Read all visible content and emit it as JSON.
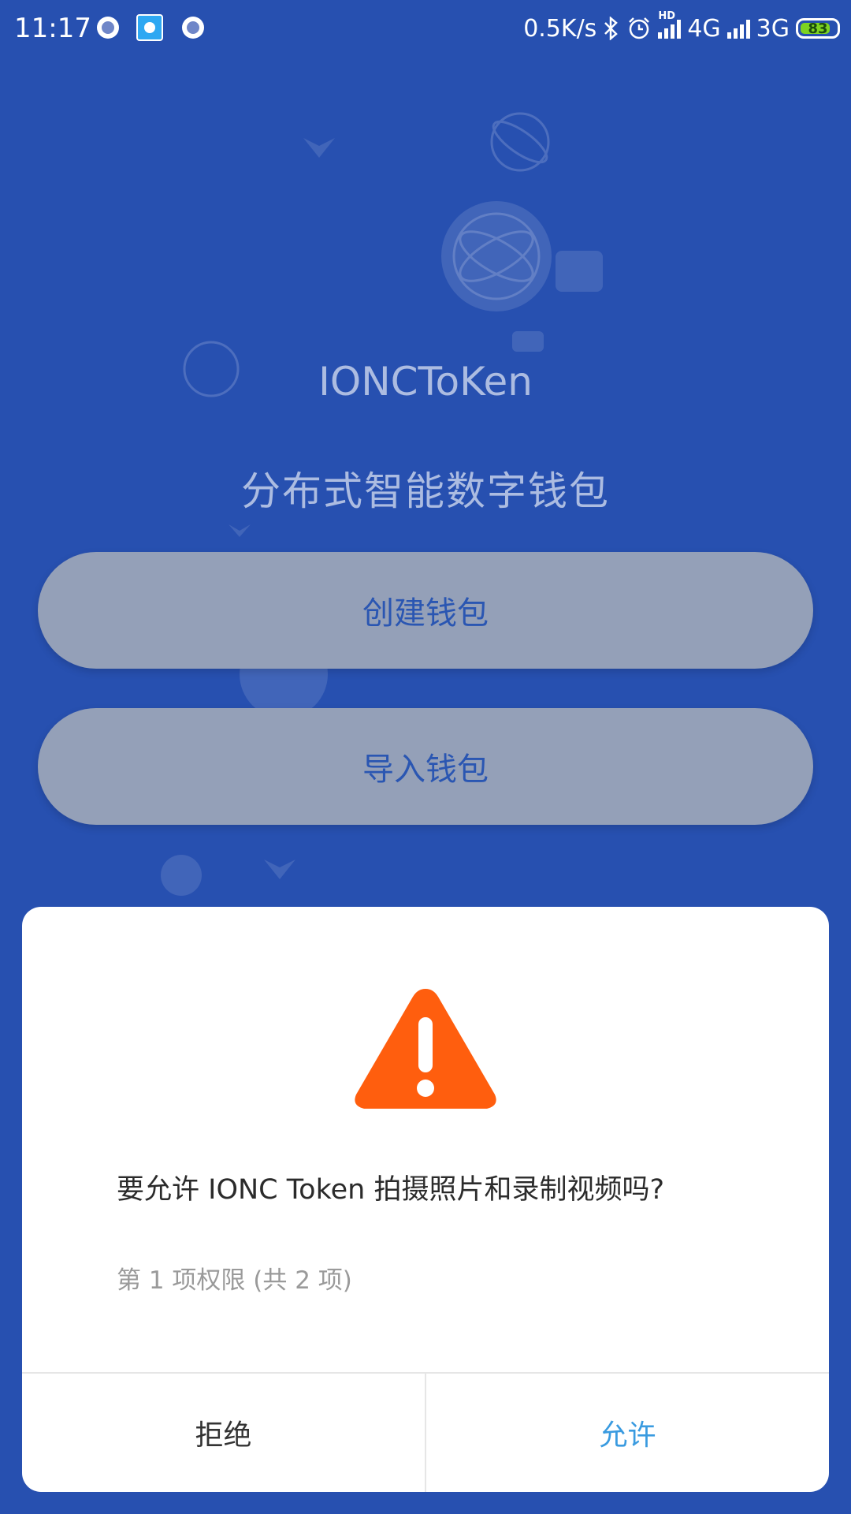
{
  "status_bar": {
    "time": "11:17",
    "speed": "0.5K/s",
    "network_primary": "4G",
    "network_hd": "HD",
    "network_secondary": "3G",
    "battery": "83",
    "icons": [
      "notification-ring-icon",
      "notification-app-icon",
      "notification-ring-icon",
      "bluetooth-icon",
      "alarm-icon",
      "signal-icon",
      "signal-icon",
      "battery-icon"
    ],
    "battery_level": 0.83
  },
  "app": {
    "title": "IONCToKen",
    "subtitle": "分布式智能数字钱包",
    "create_label": "创建钱包",
    "import_label": "导入钱包"
  },
  "dialog": {
    "question": "要允许 IONC Token 拍摄照片和录制视频吗?",
    "sub": "第 1 项权限 (共 2 项)",
    "deny_label": "拒绝",
    "allow_label": "允许",
    "icon": "warning-icon"
  },
  "colors": {
    "background": "#2750b0",
    "button_bg": "#94a0b8",
    "button_text": "#2a56b2",
    "warning": "#ff5e0e",
    "allow_text": "#3a9be0",
    "battery": "#7ed321"
  }
}
